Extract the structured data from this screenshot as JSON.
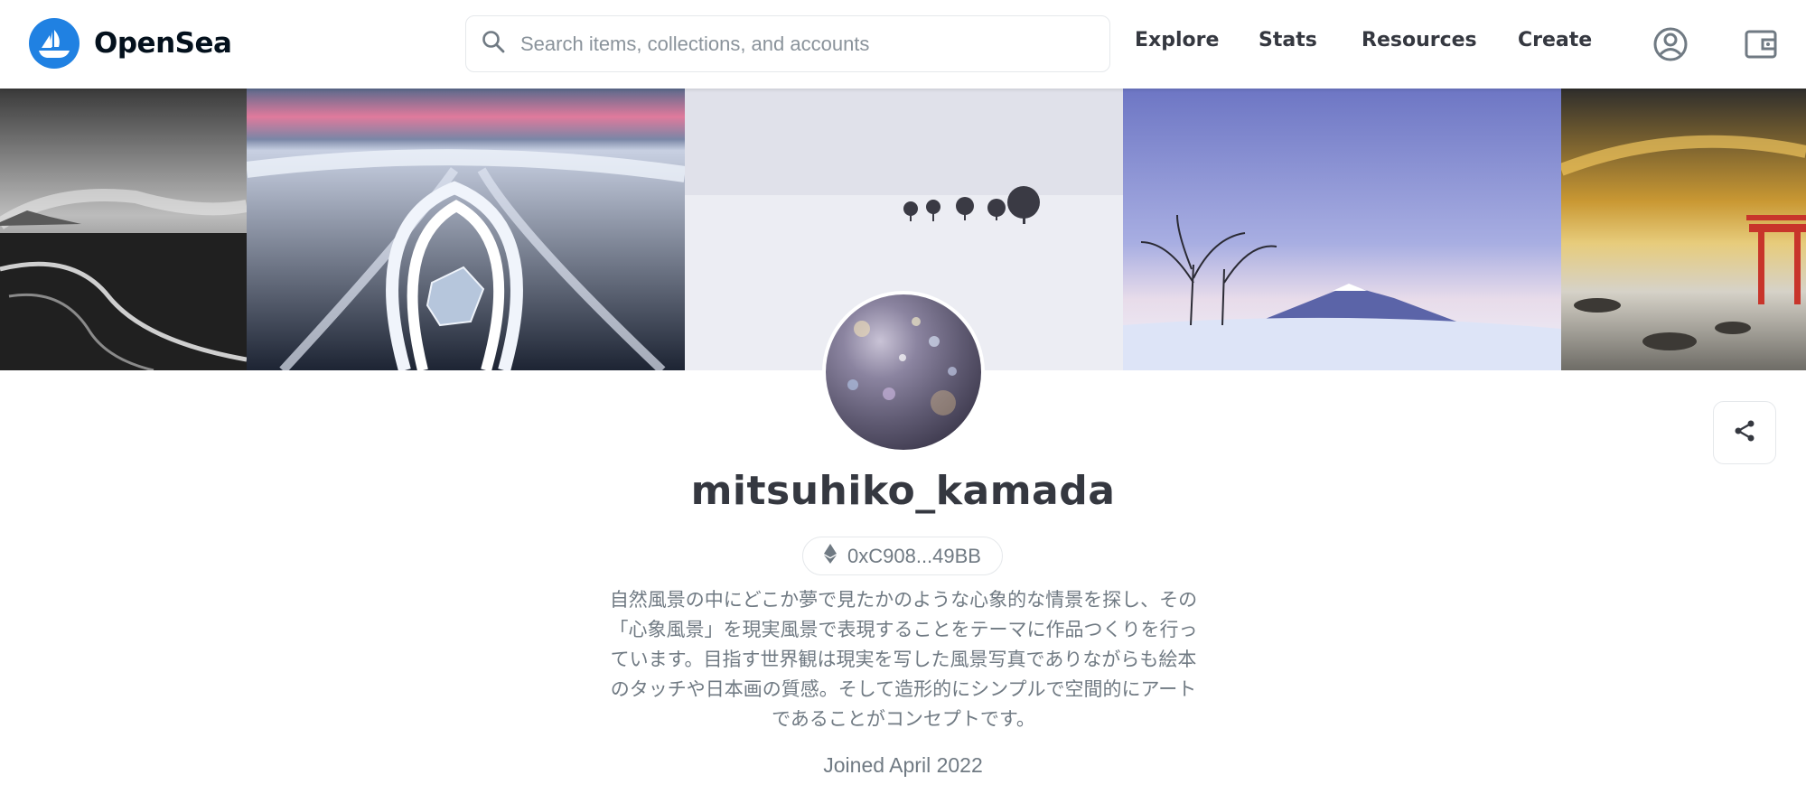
{
  "header": {
    "brand": "OpenSea",
    "search": {
      "placeholder": "Search items, collections, and accounts",
      "value": ""
    },
    "nav": [
      {
        "label": "Explore"
      },
      {
        "label": "Stats"
      },
      {
        "label": "Resources"
      },
      {
        "label": "Create"
      }
    ],
    "icons": {
      "account": "account-circle-icon",
      "wallet": "wallet-icon",
      "search": "search-icon"
    }
  },
  "banner": {
    "panels": [
      {
        "name": "dark-coastline-photo"
      },
      {
        "name": "ice-on-beach-photo"
      },
      {
        "name": "snowy-trees-photo"
      },
      {
        "name": "mountain-twilight-photo"
      },
      {
        "name": "torii-gate-sunset-photo"
      }
    ]
  },
  "profile": {
    "username": "mitsuhiko_kamada",
    "address": "0xC908...49BB",
    "bio_lines": [
      "自然風景の中にどこか夢で見たかのような心象的な情景を探し、その",
      "「心象風景」を現実風景で表現することをテーマに作品つくりを行っ",
      "ています。目指す世界観は現実を写した風景写真でありながらも絵本",
      "のタッチや日本画の質感。そして造形的にシンプルで空間的にアート",
      "であることがコンセプトです。"
    ],
    "joined": "Joined April 2022"
  },
  "colors": {
    "brand": "#2081e2",
    "text": "#353840",
    "muted": "#707a83"
  }
}
